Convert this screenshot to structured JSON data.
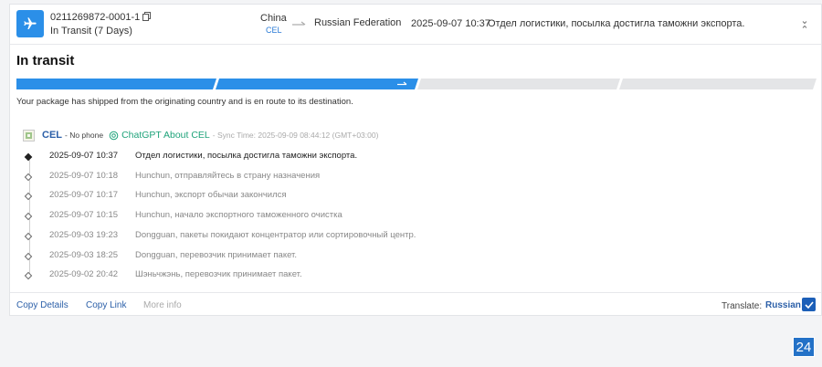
{
  "header": {
    "carrier_icon": "airplane-icon",
    "tracking_number": "0211269872-0001-1",
    "copy_icon": "copy-icon",
    "transit_status": "In Transit (7 Days)",
    "origin_country": "China",
    "origin_carrier": "CEL",
    "destination_country": "Russian Federation",
    "latest_time": "2025-09-07 10:37",
    "latest_description": "Отдел логистики, посылка достигла таможни экспорта.",
    "expand_icon": "expand-icon"
  },
  "status": {
    "title": "In transit",
    "progress_completed_steps": 2,
    "progress_total_steps": 4,
    "summary": "Your package has shipped from the originating country and is en route to its destination."
  },
  "carrier": {
    "name": "CEL",
    "phone": "- No phone",
    "chatgpt_label": "ChatGPT About CEL",
    "sync_time": "- Sync Time: 2025-09-09 08:44:12 (GMT+03:00)"
  },
  "events": [
    {
      "time": "2025-09-07 10:37",
      "description": "Отдел логистики, посылка достигла таможни экспорта."
    },
    {
      "time": "2025-09-07 10:18",
      "description": "Hunchun, отправляйтесь в страну назначения"
    },
    {
      "time": "2025-09-07 10:17",
      "description": "Hunchun, экспорт обычаи закончился"
    },
    {
      "time": "2025-09-07 10:15",
      "description": "Hunchun, начало экспортного таможенного очистка"
    },
    {
      "time": "2025-09-03 19:23",
      "description": "Dongguan, пакеты покидают концентратор или сортировочный центр."
    },
    {
      "time": "2025-09-03 18:25",
      "description": "Dongguan, перевозчик принимает пакет."
    },
    {
      "time": "2025-09-02 20:42",
      "description": "Шэньчжэнь, перевозчик принимает пакет."
    }
  ],
  "footer": {
    "copy_details": "Copy Details",
    "copy_link": "Copy Link",
    "more_info": "More info",
    "translate_label": "Translate:",
    "translate_language": "Russian"
  },
  "badge": "24",
  "colors": {
    "accent": "#2b8fe8",
    "progress_inactive": "#e4e5e7",
    "link": "#2b5fa8",
    "chatgpt": "#1fa37a"
  }
}
